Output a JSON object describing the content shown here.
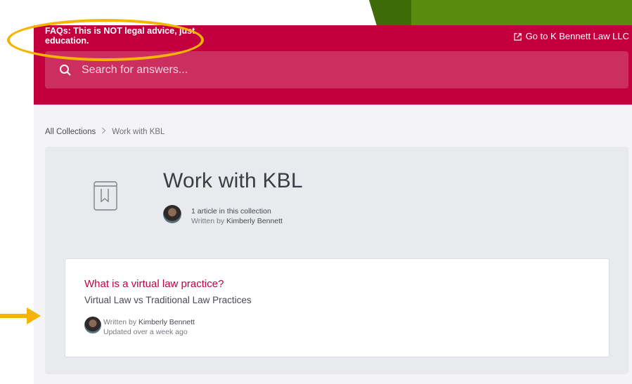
{
  "header": {
    "brand_text": "FAQs: This is NOT legal advice, just education.",
    "external_link": "Go to K Bennett Law LLC",
    "search_placeholder": "Search for answers..."
  },
  "breadcrumb": {
    "root": "All Collections",
    "current": "Work with KBL"
  },
  "collection": {
    "title": "Work with KBL",
    "article_count": "1 article in this collection",
    "written_by_prefix": "Written by",
    "author": "Kimberly Bennett"
  },
  "articles": [
    {
      "title": "What is a virtual law practice?",
      "subtitle": "Virtual Law vs Traditional Law Practices",
      "written_by_prefix": "Written by",
      "author": "Kimberly Bennett",
      "updated": "Updated over a week ago"
    }
  ],
  "colors": {
    "brand": "#c2003f",
    "annotation": "#f5b400",
    "slide_green": "#5a8a0e"
  },
  "icons": [
    "external-link-icon",
    "search-icon",
    "book-icon",
    "chevron-right-icon",
    "arrow-right-icon"
  ]
}
